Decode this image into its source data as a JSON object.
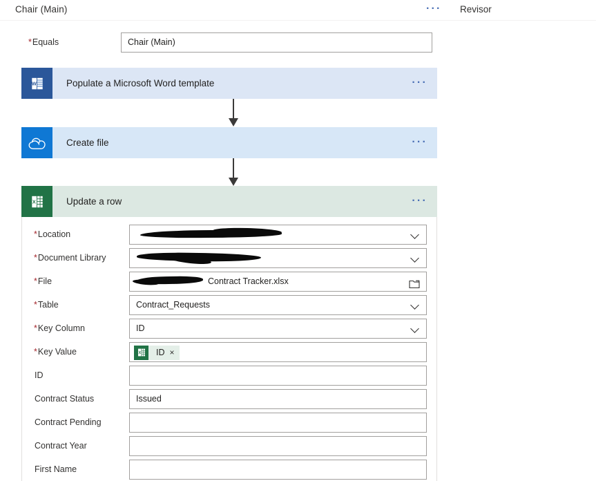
{
  "topbar": {
    "title": "Chair (Main)",
    "ellipsis": "···",
    "ellipsis_icon": "more-options-icon",
    "revisor_label": "Revisor"
  },
  "condition": {
    "equals_label": "Equals",
    "equals_required": "*",
    "equals_value": "Chair (Main)"
  },
  "cards": [
    {
      "id": "word",
      "title": "Populate a Microsoft Word template",
      "icon": "word-icon",
      "icon_letter": "W",
      "header_color": "#dce6f5",
      "icon_color": "#2b579a",
      "ellipsis": "···"
    },
    {
      "id": "onedrive",
      "title": "Create file",
      "icon": "onedrive-cloud-icon",
      "header_color": "#d7e7f7",
      "icon_color": "#0f78d4",
      "ellipsis": "···"
    },
    {
      "id": "excel",
      "title": "Update a row",
      "icon": "excel-icon",
      "icon_letter": "X",
      "header_color": "#dce8e2",
      "icon_color": "#217346",
      "ellipsis": "···"
    }
  ],
  "update_row_fields": [
    {
      "label": "Location",
      "required": "*",
      "value": "",
      "control": "dropdown",
      "redacted": "heavy"
    },
    {
      "label": "Document Library",
      "required": "*",
      "value": "",
      "control": "dropdown",
      "redacted": "heavy"
    },
    {
      "label": "File",
      "required": "*",
      "value": "Contract Tracker.xlsx",
      "control": "filepicker",
      "redacted": "partial"
    },
    {
      "label": "Table",
      "required": "*",
      "value": "Contract_Requests",
      "control": "dropdown",
      "redacted": "none"
    },
    {
      "label": "Key Column",
      "required": "*",
      "value": "ID",
      "control": "dropdown",
      "redacted": "none"
    },
    {
      "label": "Key Value",
      "required": "*",
      "value": "",
      "control": "token",
      "redacted": "none"
    },
    {
      "label": "ID",
      "required": "",
      "value": "",
      "control": "text",
      "redacted": "none"
    },
    {
      "label": "Contract Status",
      "required": "",
      "value": "Issued",
      "control": "text",
      "redacted": "none"
    },
    {
      "label": "Contract Pending",
      "required": "",
      "value": "",
      "control": "text",
      "redacted": "none"
    },
    {
      "label": "Contract Year",
      "required": "",
      "value": "",
      "control": "text",
      "redacted": "none"
    },
    {
      "label": "First Name",
      "required": "",
      "value": "",
      "control": "text",
      "redacted": "none"
    }
  ],
  "key_value_token": {
    "label": "ID",
    "remove_glyph": "×",
    "icon": "excel-token-icon",
    "icon_letter": "X"
  },
  "colors": {
    "required_star": "#a4262c",
    "ellipsis_blue": "#4a6fb5",
    "word_blue": "#2b579a",
    "onedrive_blue": "#0f78d4",
    "excel_green": "#217346",
    "border_gray": "#a19f9d"
  }
}
